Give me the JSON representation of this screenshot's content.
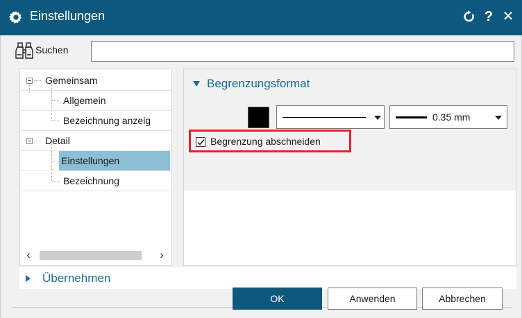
{
  "window": {
    "title": "Einstellungen",
    "icon": "gear-icon",
    "reset_icon": "reset-icon",
    "help_label": "?",
    "close_label": "✕"
  },
  "search": {
    "label": "Suchen",
    "value": "",
    "placeholder": ""
  },
  "tree": {
    "items": [
      {
        "label": "Gemeinsam",
        "level": 0,
        "expanded": true
      },
      {
        "label": "Allgemein",
        "level": 1
      },
      {
        "label": "Bezeichnung anzeig",
        "level": 1
      },
      {
        "label": "Detail",
        "level": 0,
        "expanded": true
      },
      {
        "label": "Einstellungen",
        "level": 1,
        "selected": true
      },
      {
        "label": "Bezeichnung",
        "level": 1
      }
    ],
    "scroll_left": "‹",
    "scroll_right": "›"
  },
  "section": {
    "title": "Begrenzungsformat",
    "color_value": "#000000",
    "line_width": "0.35 mm",
    "checkbox_label": "Begrenzung abschneiden",
    "checkbox_checked": true
  },
  "collapsed_section": {
    "title": "Übernehmen"
  },
  "buttons": {
    "ok": "OK",
    "apply": "Anwenden",
    "cancel": "Abbrechen"
  },
  "colors": {
    "titlebar": "#0f587d",
    "accent_text": "#1b6c92",
    "selection": "#8cbfd6",
    "highlight_border": "#e8212a"
  }
}
